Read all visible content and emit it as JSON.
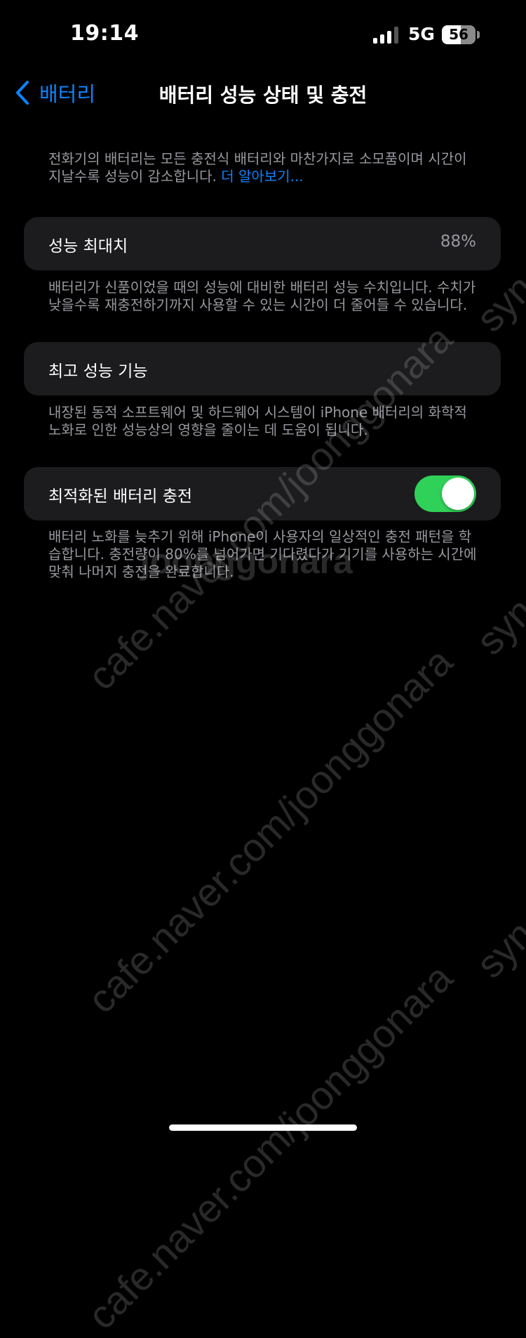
{
  "status_bar": {
    "time": "19:14",
    "network": "5G",
    "battery_level": "56",
    "battery_fraction": 0.56
  },
  "nav": {
    "back_label": "배터리",
    "title": "배터리 성능 상태 및 충전"
  },
  "intro": {
    "text": "전화기의 배터리는 모든 충전식 배터리와 마찬가지로 소모품이며 시간이 지날수록 성능이 감소합니다. ",
    "link": "더 알아보기..."
  },
  "max_capacity": {
    "label": "성능 최대치",
    "value": "88%",
    "description": "배터리가 신품이었을 때의 성능에 대비한 배터리 성능 수치입니다. 수치가 낮을수록 재충전하기까지 사용할 수 있는 시간이 더 줄어들 수 있습니다."
  },
  "peak_performance": {
    "label": "최고 성능 기능",
    "description": "내장된 동적 소프트웨어 및 하드웨어 시스템이 iPhone 배터리의 화학적 노화로 인한 성능상의 영향을 줄이는 데 도움이 됩니다."
  },
  "optimized_charging": {
    "label": "최적화된 배터리 충전",
    "enabled": true,
    "description": "배터리 노화를 늦추기 위해 iPhone이 사용자의 일상적인 충전 패턴을 학습합니다. 충전량이 80%를 넘어가면 기다렸다가 기기를 사용하는 시간에 맞춰 나머지 충전을 완료합니다."
  },
  "watermarks": [
    "cafe.naver.com/joonggonara",
    "cafe.naver.com/joonggonara",
    "cafe.naver.com/joonggonara",
    "joonggonara",
    "syn",
    "syn",
    "syn"
  ],
  "colors": {
    "background": "#000000",
    "cell": "#1c1c1e",
    "accent": "#0a84ff",
    "toggle_on": "#30d158",
    "secondary_text": "#98989f"
  }
}
